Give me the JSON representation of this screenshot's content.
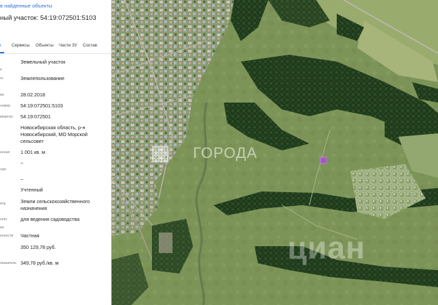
{
  "panel": {
    "back_link": "в найденные объекты",
    "title": "ный участок: 54:19:072501:5103",
    "tabs": [
      {
        "label": "я"
      },
      {
        "label": "Сервисы"
      },
      {
        "label": "Объекты"
      },
      {
        "label": "Части ЗУ"
      },
      {
        "label": "Состав"
      }
    ],
    "rows": [
      {
        "label": "",
        "value": "Земельный участок"
      },
      {
        "label": "е",
        "value": ""
      },
      {
        "label": "го",
        "value": "Землепользование"
      },
      {
        "label": "",
        "value": ""
      },
      {
        "label": "ия",
        "value": "28.02.2018"
      },
      {
        "label": "номер",
        "value": "54:19:072501:5103"
      },
      {
        "label": "квартал",
        "value": "54:19:072501"
      },
      {
        "label": "",
        "value": "Новосибирская область, р-н Новосибирский, МО Морской сельсовет"
      },
      {
        "label": "енная",
        "value": "1 001 кв. м"
      },
      {
        "label": "",
        "value": "–"
      },
      {
        "label": "ная",
        "value": ""
      },
      {
        "label": "",
        "value": "–"
      },
      {
        "label": "",
        "value": "Учтенный"
      },
      {
        "label": "ель",
        "value": "Земли сельскохозяйственного назначения"
      },
      {
        "label": "ного",
        "value": "для ведения садоводства"
      },
      {
        "label": "ия",
        "value": ""
      },
      {
        "label": "енности",
        "value": "Частная"
      },
      {
        "label": "",
        "value": "350 129,78 руб."
      },
      {
        "label": "оказатель",
        "value": "349,78 руб./кв. м"
      }
    ]
  },
  "map": {
    "watermark_1": "ГОРОДА",
    "watermark_2": "циан"
  },
  "colors": {
    "accent": "#2f6fd6",
    "parcel": "#b13cff"
  }
}
